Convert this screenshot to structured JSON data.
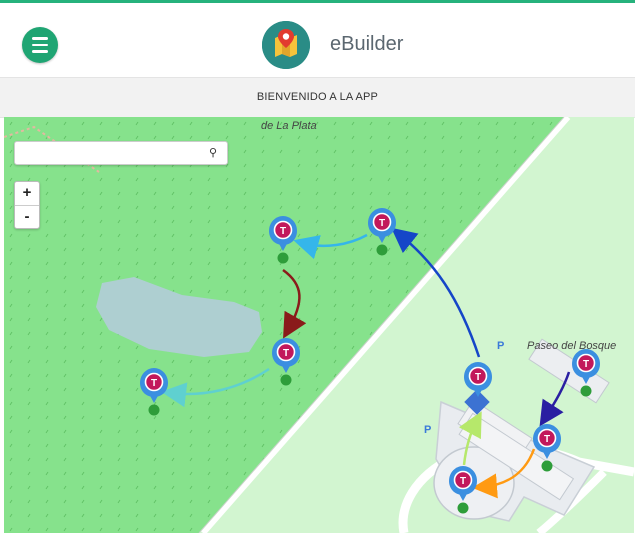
{
  "app": {
    "title": "eBuilder",
    "welcome": "BIENVENIDO A LA APP"
  },
  "icons": {
    "menu": "hamburger-menu-icon",
    "logo": "map-pin-logo-icon",
    "search": "magnifier-icon"
  },
  "colors": {
    "accent": "#1fa573",
    "map_park": "#86e28c",
    "map_background": "#d2f5d0",
    "lake": "#aecfd1",
    "marker": "#3b8fe0",
    "marker_badge": "#c2185b",
    "dot": "#2e9d3a"
  },
  "map": {
    "labels": {
      "street_top": "de La Plata",
      "street_right": "Paseo del Bosque",
      "parking": "P",
      "marker_letter": "T"
    },
    "zoom": {
      "in": "+",
      "out": "-"
    },
    "search": {
      "placeholder": "",
      "value": ""
    },
    "routes": [
      {
        "from": "marker-6",
        "to": "marker-2",
        "color": "#1546c8"
      },
      {
        "from": "marker-2",
        "to": "marker-1",
        "color": "#35b6ea"
      },
      {
        "from": "marker-1",
        "to": "marker-3",
        "color": "#8a1b1b"
      },
      {
        "from": "marker-3",
        "to": "marker-4",
        "color": "#5fd0d0"
      },
      {
        "from": "marker-5",
        "to": "marker-7",
        "color": "#2a1fa2"
      },
      {
        "from": "marker-7",
        "to": "marker-8",
        "color": "#ff9a12"
      },
      {
        "from": "marker-8",
        "to": "marker-6",
        "color": "#b6e86b"
      }
    ]
  }
}
